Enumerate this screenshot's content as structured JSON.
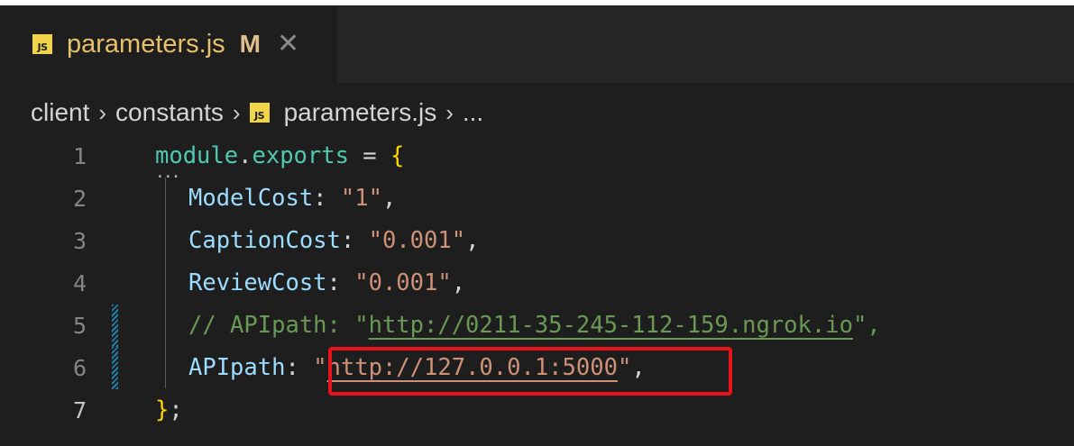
{
  "tab": {
    "icon": "js-file-icon",
    "badge": "JS",
    "filename": "parameters.js",
    "modified": "M",
    "close": "✕"
  },
  "breadcrumb": {
    "items": [
      "client",
      "constants",
      "parameters.js",
      "..."
    ],
    "separator": "›",
    "file_badge": "JS"
  },
  "editor": {
    "line_numbers": [
      "1",
      "2",
      "3",
      "4",
      "5",
      "6",
      "7"
    ],
    "lines": {
      "l1": {
        "module": "module",
        "dot": ".",
        "exports": "exports",
        "eq": " = ",
        "brace": "{"
      },
      "l2": {
        "key": "ModelCost",
        "colon": ": ",
        "val": "\"1\"",
        "comma": ","
      },
      "l3": {
        "key": "CaptionCost",
        "colon": ": ",
        "val": "\"0.001\"",
        "comma": ","
      },
      "l4": {
        "key": "ReviewCost",
        "colon": ": ",
        "val": "\"0.001\"",
        "comma": ","
      },
      "l5": {
        "prefix": "// APIpath: \"",
        "url": "http://0211-35-245-112-159.ngrok.io",
        "suffix": "\","
      },
      "l6": {
        "key": "APIpath",
        "colon": ": ",
        "q1": "\"",
        "url": "http://127.0.0.1:5000",
        "q2": "\"",
        "comma": ","
      },
      "l7": {
        "brace": "}",
        "semi": ";"
      }
    },
    "fold_marker": "..."
  },
  "colors": {
    "background": "#1e1e1e",
    "tab_text": "#e6c06a",
    "js_badge": "#f0d44c",
    "highlight_box": "#e8141b",
    "git_modified": "#1b81a8"
  }
}
